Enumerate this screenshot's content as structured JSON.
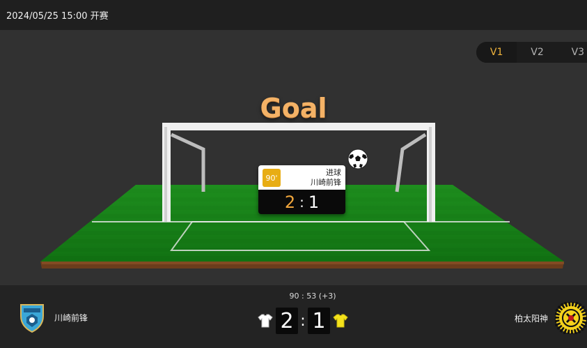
{
  "header": {
    "title": "2024/05/25 15:00 开赛"
  },
  "view_tabs": [
    {
      "label": "V1",
      "active": true
    },
    {
      "label": "V2",
      "active": false
    },
    {
      "label": "V3",
      "active": false
    }
  ],
  "animation": {
    "event_title": "Goal",
    "popup": {
      "minute": "90'",
      "event": "进球",
      "team": "川崎前锋",
      "home_score": "2",
      "separator": ":",
      "away_score": "1"
    }
  },
  "match": {
    "clock": "90 : 53  (+3)",
    "home": {
      "name": "川崎前锋",
      "score": "2",
      "kit_color": "#ffffff"
    },
    "away": {
      "name": "柏太阳神",
      "score": "1",
      "kit_color": "#f5e21b"
    },
    "separator": ":"
  },
  "colors": {
    "accent": "#f0b43c",
    "pitch": "#1a8a1a",
    "goal_text": "#f4b266"
  },
  "icons": [
    "ball-icon",
    "home-crest-icon",
    "away-crest-icon",
    "home-shirt-icon",
    "away-shirt-icon"
  ]
}
